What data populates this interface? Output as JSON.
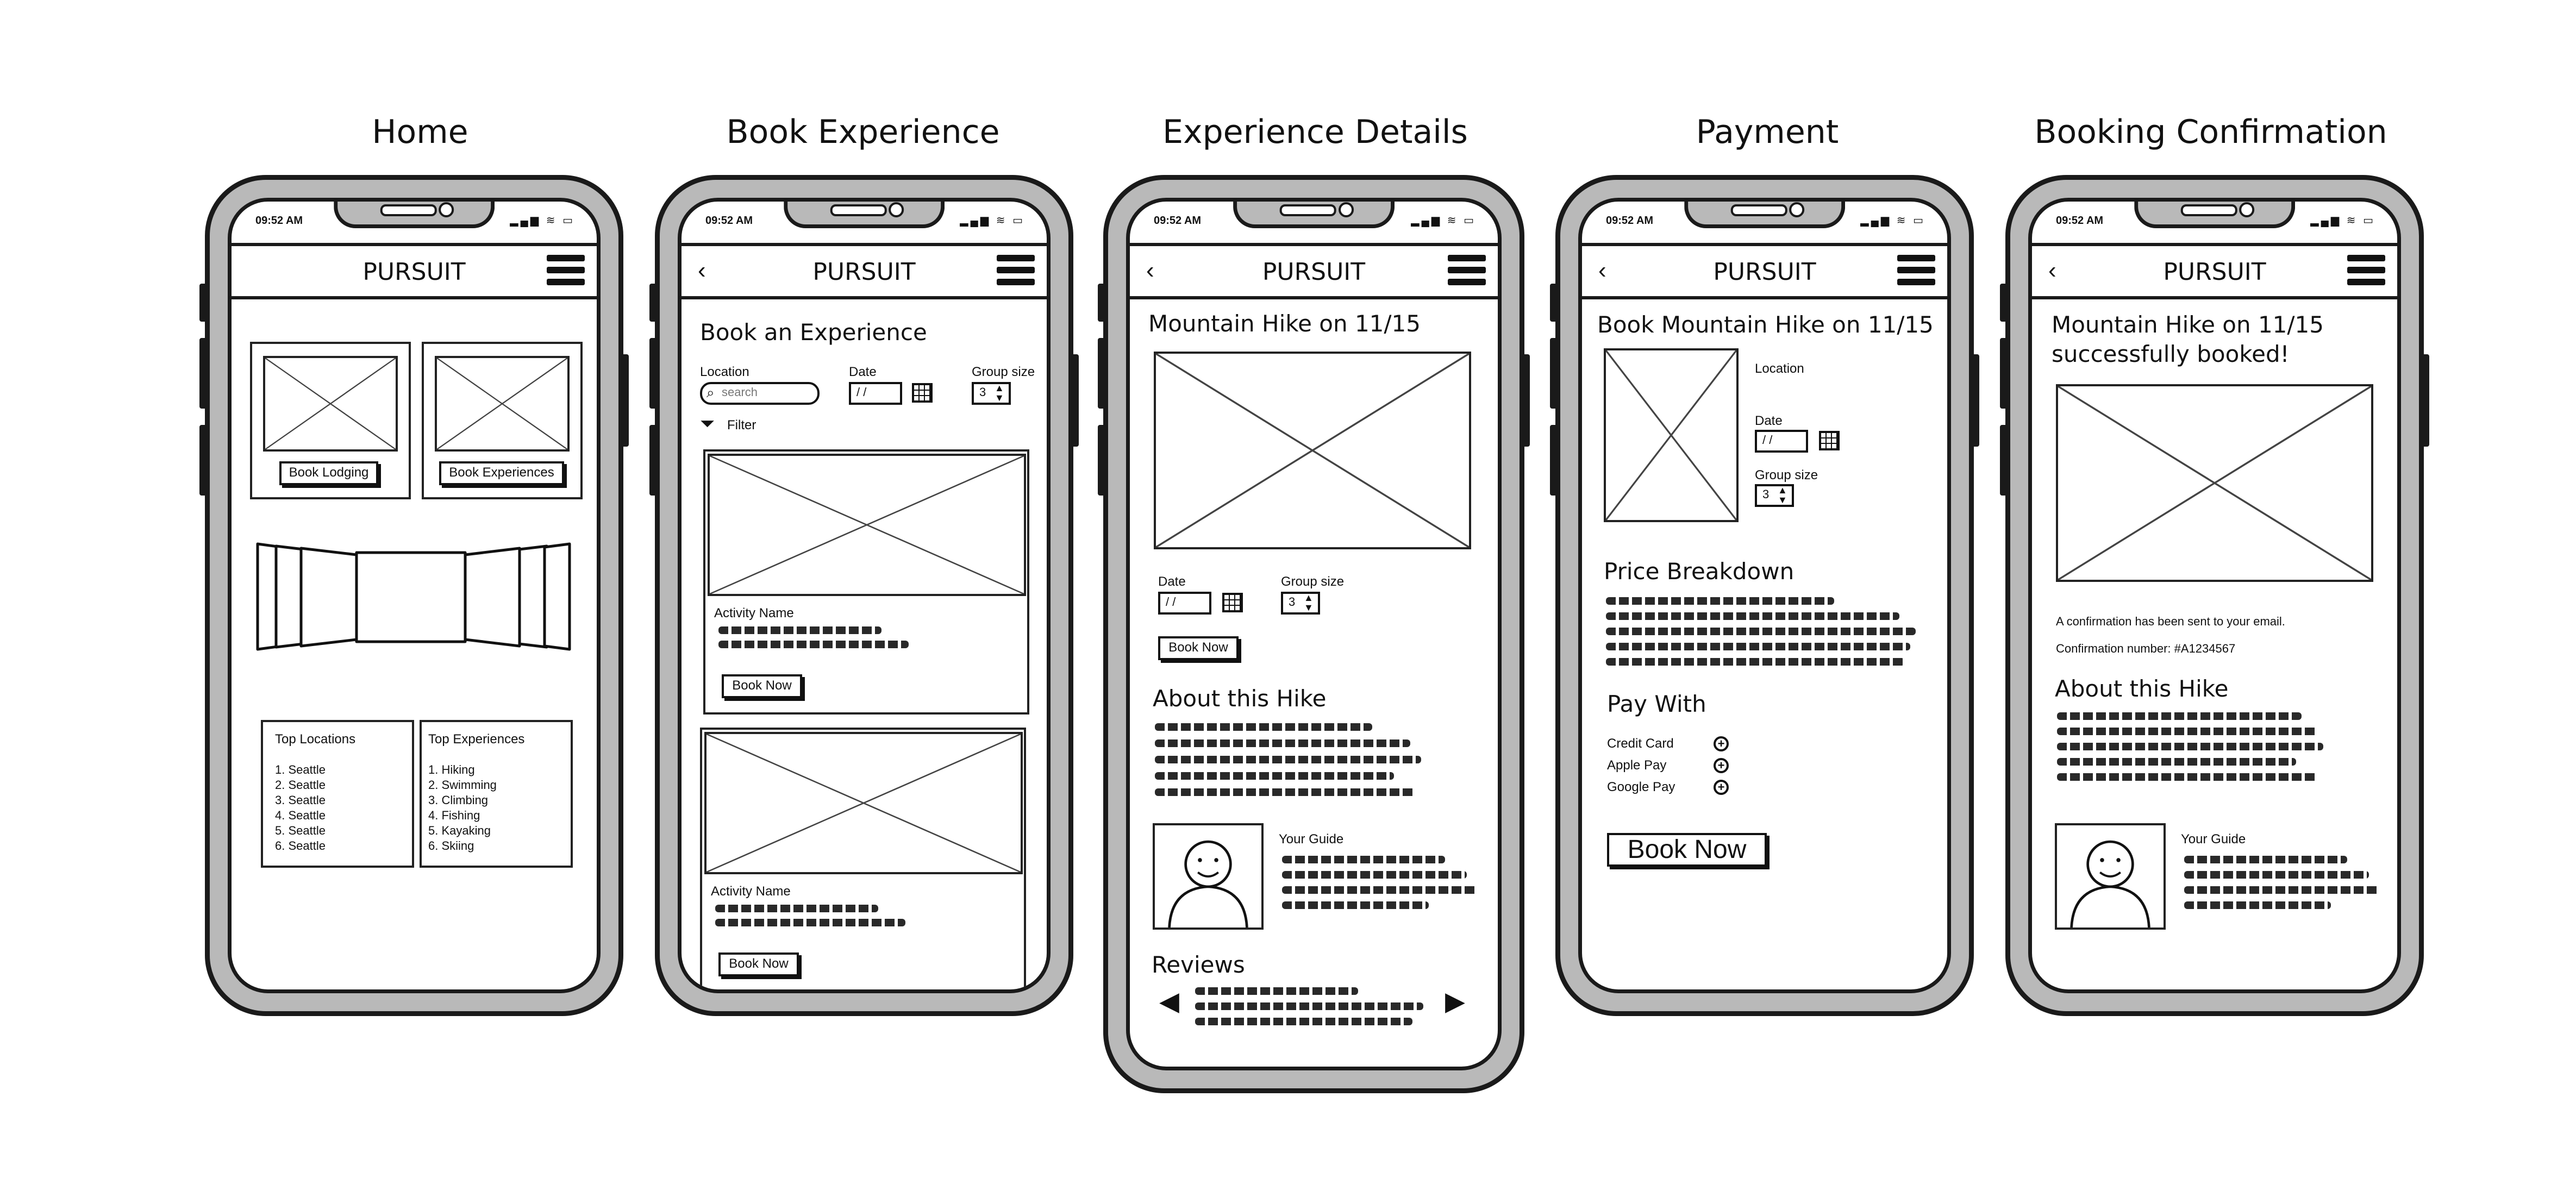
{
  "status": {
    "time": "09:52 AM",
    "icons": "▂▄▆ ≋ ▭"
  },
  "brand": "PURSUIT",
  "back_glyph": "‹",
  "screens": {
    "home": {
      "title": "Home",
      "book_lodging": "Book Lodging",
      "book_experiences": "Book Experiences",
      "top_locations": {
        "heading": "Top Locations",
        "items": [
          "1. Seattle",
          "2. Seattle",
          "3. Seattle",
          "4. Seattle",
          "5. Seattle",
          "6. Seattle"
        ]
      },
      "top_experiences": {
        "heading": "Top Experiences",
        "items": [
          "1. Hiking",
          "2. Swimming",
          "3. Climbing",
          "4. Fishing",
          "5. Kayaking",
          "6. Skiing"
        ]
      }
    },
    "book": {
      "title": "Book Experience",
      "heading": "Book an Experience",
      "location_label": "Location",
      "search_placeholder": "search",
      "date_label": "Date",
      "date_value": "/ /",
      "group_label": "Group size",
      "group_value": "3",
      "filter": "Filter",
      "cards": [
        {
          "name": "Activity Name",
          "button": "Book Now"
        },
        {
          "name": "Activity Name",
          "button": "Book Now"
        }
      ]
    },
    "details": {
      "title": "Experience Details",
      "heading": "Mountain Hike on 11/15",
      "date_label": "Date",
      "date_value": "/ /",
      "group_label": "Group size",
      "group_value": "3",
      "book_now": "Book Now",
      "about": "About this Hike",
      "guide": "Your Guide",
      "reviews": "Reviews"
    },
    "payment": {
      "title": "Payment",
      "heading": "Book Mountain Hike on 11/15",
      "location_label": "Location",
      "date_label": "Date",
      "date_value": "/ /",
      "group_label": "Group size",
      "group_value": "3",
      "price_breakdown": "Price Breakdown",
      "pay_with": "Pay With",
      "methods": [
        "Credit Card",
        "Apple Pay",
        "Google Pay"
      ],
      "book_now": "Book Now"
    },
    "confirmation": {
      "title": "Booking Confirmation",
      "heading_line1": "Mountain Hike on 11/15",
      "heading_line2": "successfully booked!",
      "email_note": "A confirmation has been sent to your email.",
      "conf_number": "Confirmation number: #A1234567",
      "about": "About this Hike",
      "guide": "Your Guide"
    }
  }
}
